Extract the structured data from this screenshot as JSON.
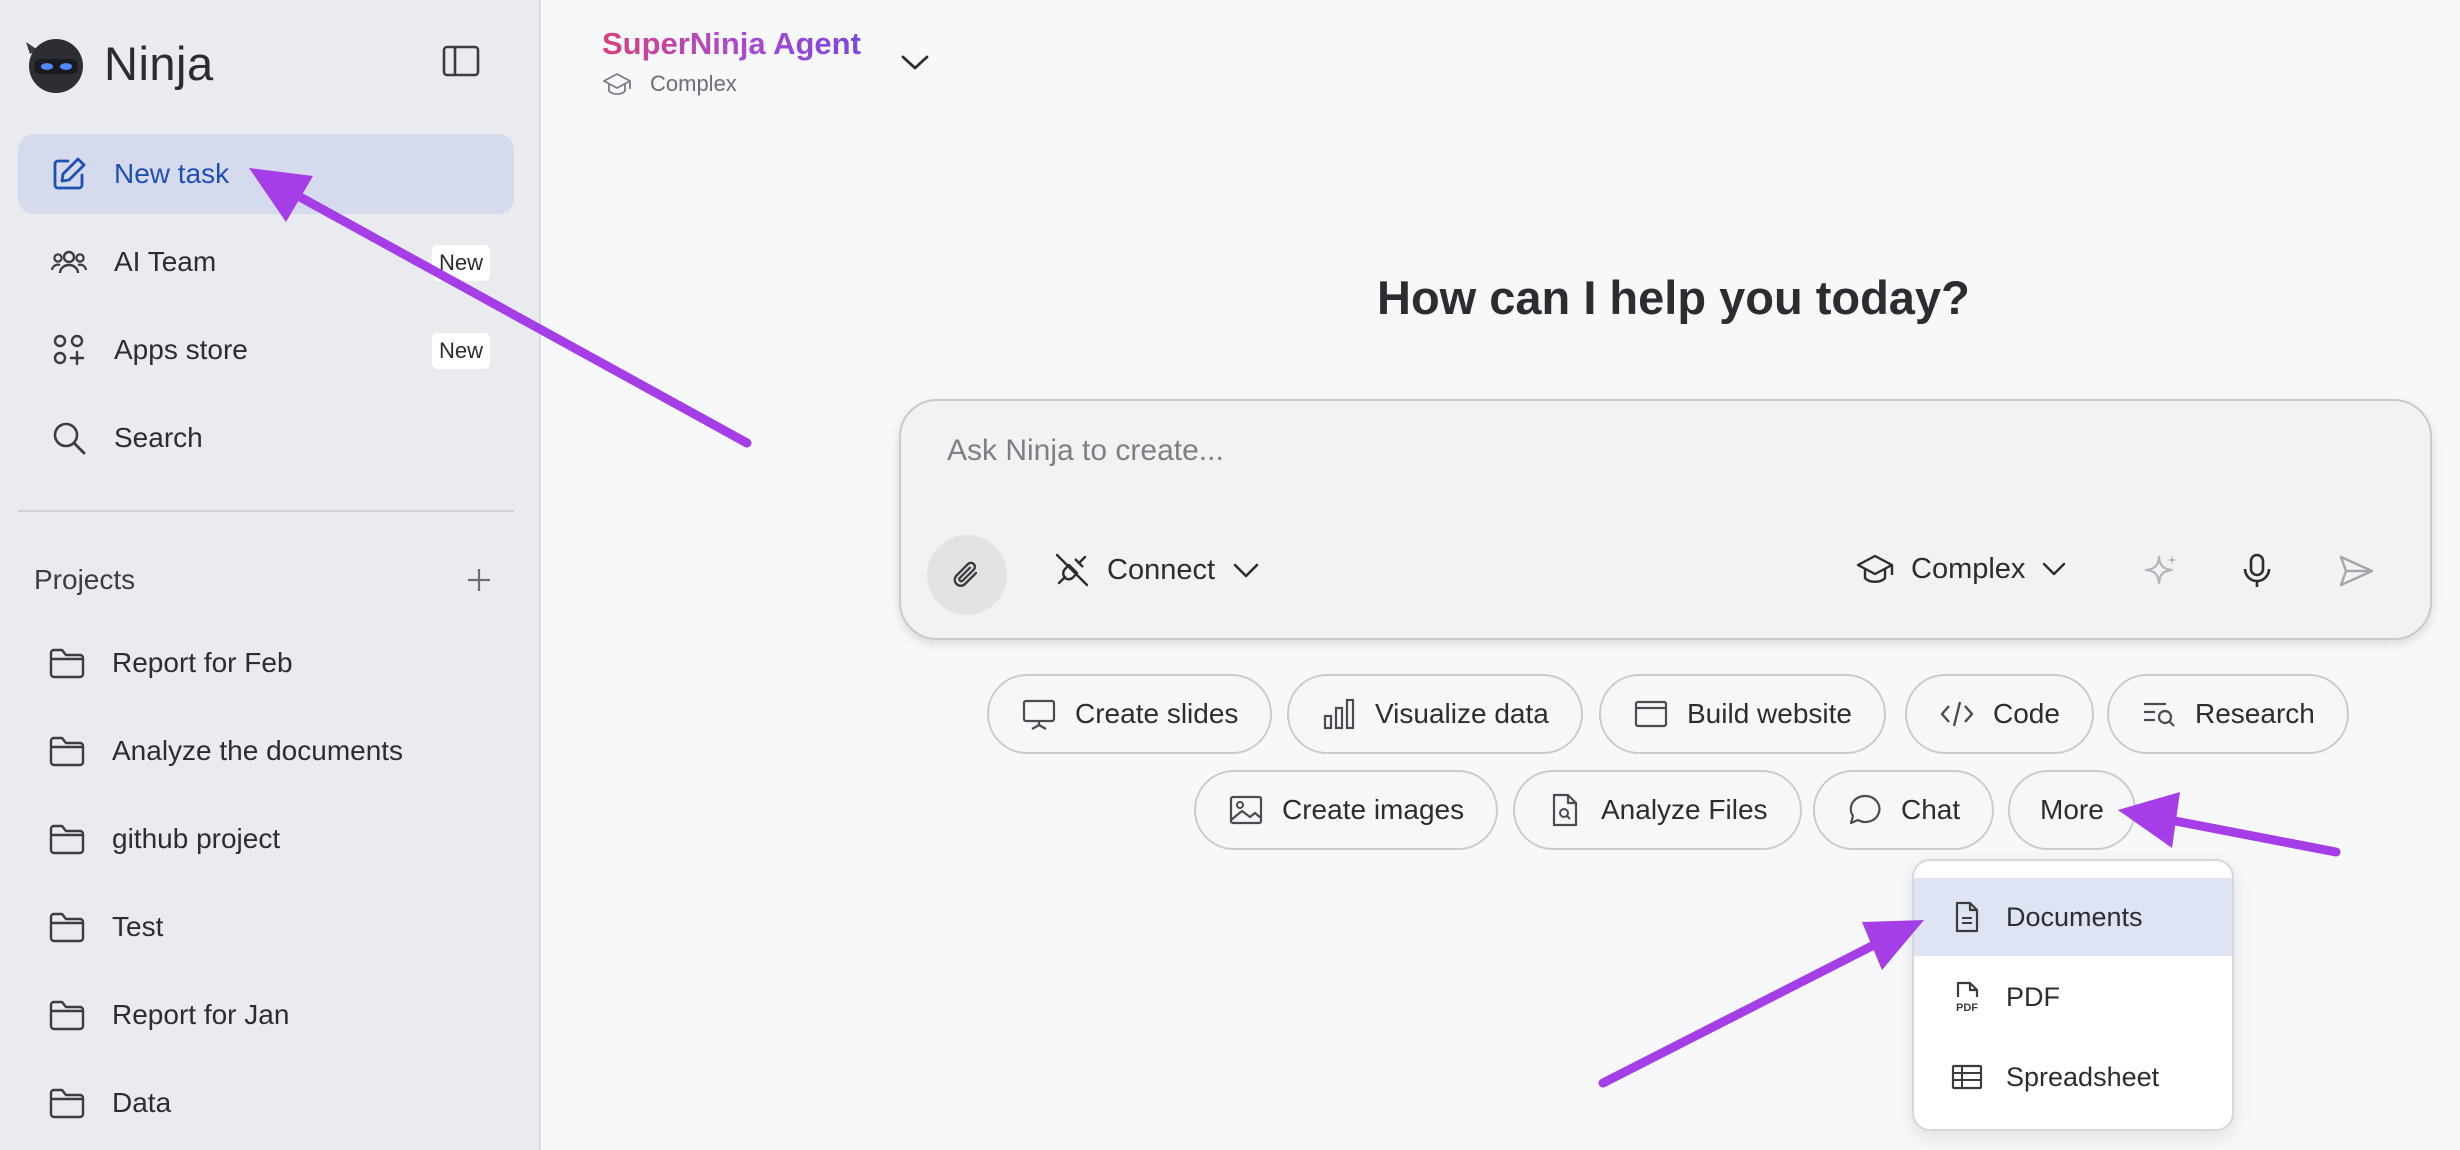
{
  "app": {
    "name": "Ninja"
  },
  "sidebar": {
    "nav": [
      {
        "label": "New task",
        "icon": "edit-icon",
        "active": true
      },
      {
        "label": "AI Team",
        "icon": "team-icon",
        "badge": "New"
      },
      {
        "label": "Apps store",
        "icon": "apps-icon",
        "badge": "New"
      },
      {
        "label": "Search",
        "icon": "search-icon"
      }
    ],
    "projects_title": "Projects",
    "projects": [
      "Report for Feb",
      "Analyze the documents",
      "github project",
      "Test",
      "Report for Jan",
      "Data"
    ]
  },
  "header": {
    "agent_name": "SuperNinja Agent",
    "agent_mode": "Complex"
  },
  "main": {
    "headline": "How can I help you today?",
    "prompt": {
      "placeholder": "Ask Ninja to create...",
      "connect_label": "Connect",
      "mode_label": "Complex"
    },
    "chips_row1": [
      "Create slides",
      "Visualize data",
      "Build website",
      "Code",
      "Research"
    ],
    "chips_row2": [
      "Create images",
      "Analyze Files",
      "Chat",
      "More"
    ],
    "more_menu": [
      "Documents",
      "PDF",
      "Spreadsheet"
    ]
  },
  "colors": {
    "accent_arrow": "#a53ee6",
    "active_nav_bg": "#d5dbec",
    "active_nav_text": "#1f4fb5",
    "brand_gradient": [
      "#d8407e",
      "#7a46e0"
    ]
  }
}
